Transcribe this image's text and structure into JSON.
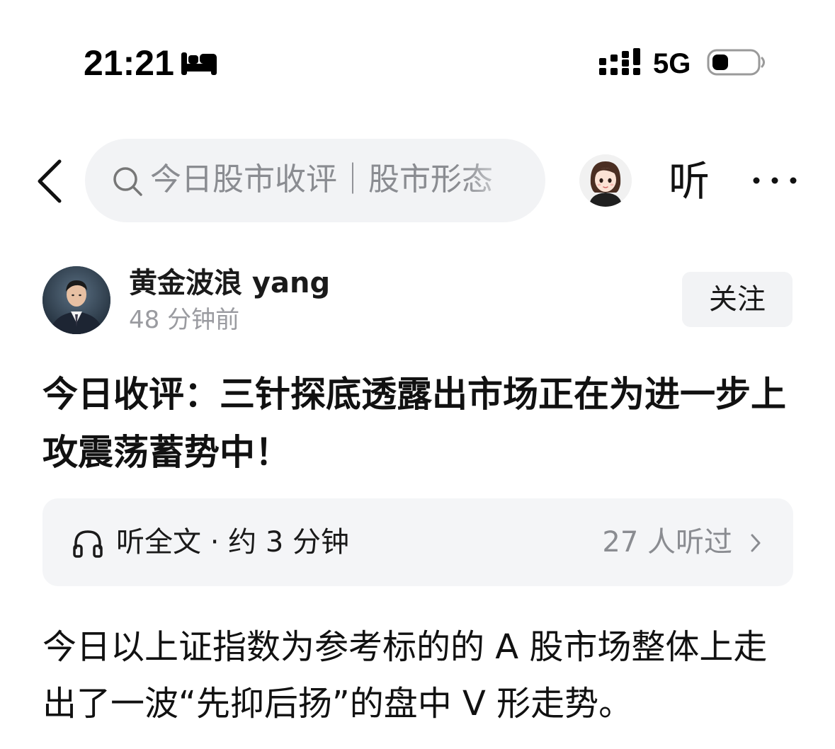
{
  "status_bar": {
    "time": "21:21",
    "network": "5G",
    "icons": [
      "bed-icon",
      "signal-icon",
      "battery-icon"
    ]
  },
  "nav": {
    "search_text": "今日股市收评｜股市形态",
    "listen_label": "听",
    "icons": [
      "back-icon",
      "search-icon",
      "more-icon"
    ]
  },
  "author": {
    "name": "黄金波浪 yang",
    "time": "48 分钟前",
    "follow_label": "关注"
  },
  "article": {
    "title": "今日收评：三针探底透露出市场正在为进一步上攻震荡蓄势中！",
    "body": "今日以上证指数为参考标的的 A 股市场整体上走出了一波“先抑后扬”的盘中 V 形走势。"
  },
  "listen_card": {
    "label": "听全文 · 约 3 分钟",
    "count": "27 人听过",
    "icons": [
      "headphones-icon",
      "chevron-right-icon"
    ]
  },
  "colors": {
    "search_bg": "#f2f3f5",
    "muted_text": "#8a8c91",
    "card_bg": "#f4f5f7"
  }
}
